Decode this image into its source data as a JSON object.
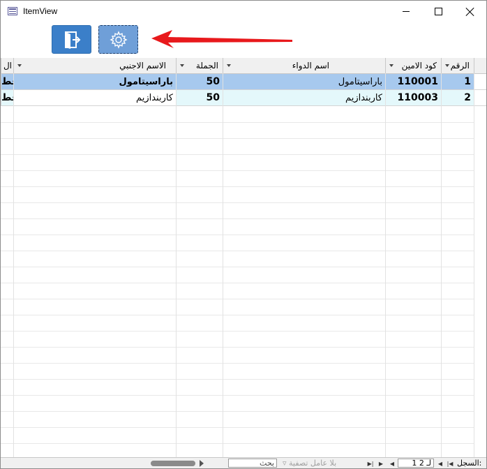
{
  "window": {
    "title": "ItemView"
  },
  "toolbar": {
    "exit_icon": "exit-door-icon",
    "settings_icon": "gear-icon"
  },
  "annotation": {
    "arrow_color": "#e8191c"
  },
  "grid": {
    "columns": [
      {
        "key": "row_no",
        "label": "الرقم"
      },
      {
        "key": "code",
        "label": "كود الامين"
      },
      {
        "key": "drug_name",
        "label": "اسم الدواء"
      },
      {
        "key": "wholesale",
        "label": "الجملة"
      },
      {
        "key": "foreign_name",
        "label": "الاسم الاجنبي"
      },
      {
        "key": "extra",
        "label": "ال"
      }
    ],
    "rows": [
      {
        "row_no": "1",
        "code": "110001",
        "drug_name": "باراسيتامول",
        "wholesale": "50",
        "foreign_name": "باراسيتامول",
        "extra": "قط"
      },
      {
        "row_no": "2",
        "code": "110003",
        "drug_name": "كاربندازيم",
        "wholesale": "50",
        "foreign_name": "كاربندازيم",
        "extra": "قط"
      }
    ],
    "selected_row_color": "#a7c9ee",
    "alt_row_color": "#e4f8fb"
  },
  "status": {
    "record_label": "السجل:",
    "record_value": "1 لـ 2",
    "filter_label": "بلا عامل تصفية",
    "search_placeholder": "بحث"
  }
}
